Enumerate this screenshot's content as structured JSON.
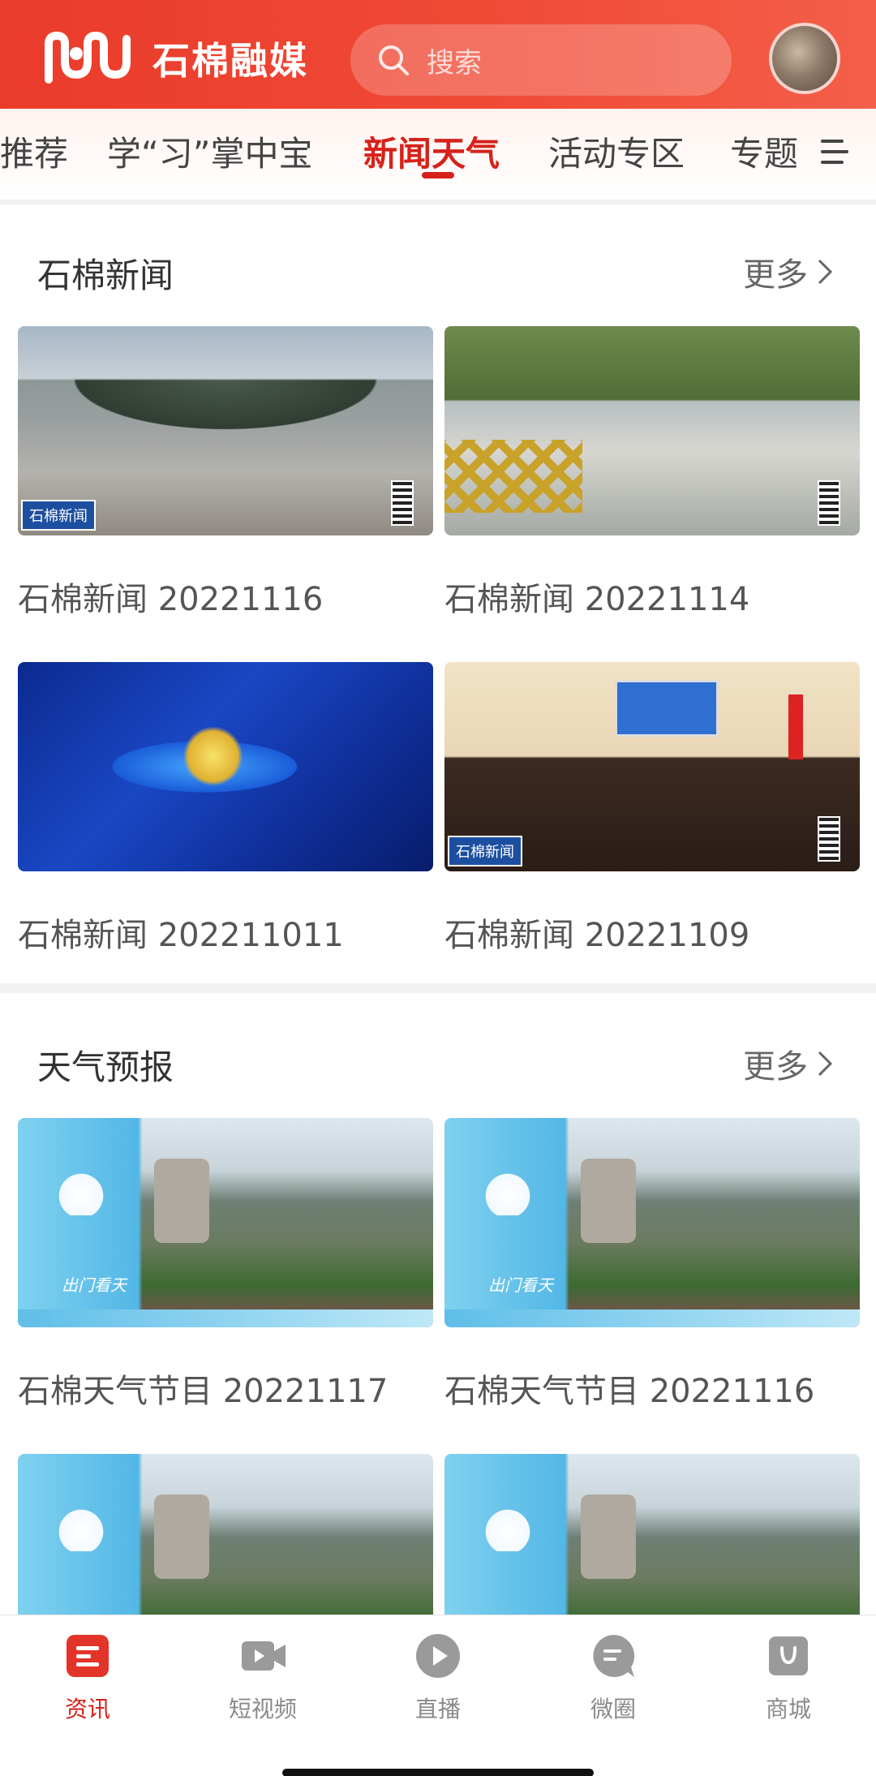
{
  "header": {
    "app_name": "石棉融媒",
    "search_placeholder": "搜索",
    "accent": "#ea3b2b"
  },
  "tabs": {
    "items": [
      "推荐",
      "学“习”掌中宝",
      "新闻天气",
      "活动专区",
      "专题"
    ],
    "active": "新闻天气"
  },
  "sections": [
    {
      "title": "石棉新闻",
      "more": "更多",
      "cards": [
        {
          "caption": "石棉新闻 20221116",
          "thumb": "city-valley",
          "badge": "石棉新闻"
        },
        {
          "caption": "石棉新闻 20221114",
          "thumb": "bridge-construction",
          "badge": ""
        },
        {
          "caption": "石棉新闻 202211011",
          "thumb": "blue-news-intro",
          "badge": ""
        },
        {
          "caption": "石棉新闻 20221109",
          "thumb": "meeting-room",
          "badge": "石棉新闻"
        }
      ]
    },
    {
      "title": "天气预报",
      "more": "更多",
      "cards": [
        {
          "caption": "石棉天气节目 20221117",
          "thumb": "weather",
          "label": "出门看天"
        },
        {
          "caption": "石棉天气节目 20221116",
          "thumb": "weather",
          "label": "出门看天"
        },
        {
          "caption": "",
          "thumb": "weather"
        },
        {
          "caption": "",
          "thumb": "weather"
        }
      ]
    }
  ],
  "bottom_nav": {
    "items": [
      {
        "label": "资讯",
        "icon": "news-icon",
        "active": true
      },
      {
        "label": "短视频",
        "icon": "video-camera-icon",
        "active": false
      },
      {
        "label": "直播",
        "icon": "play-icon",
        "active": false
      },
      {
        "label": "微圈",
        "icon": "chat-bubble-icon",
        "active": false
      },
      {
        "label": "商城",
        "icon": "shop-bag-icon",
        "active": false
      }
    ]
  }
}
